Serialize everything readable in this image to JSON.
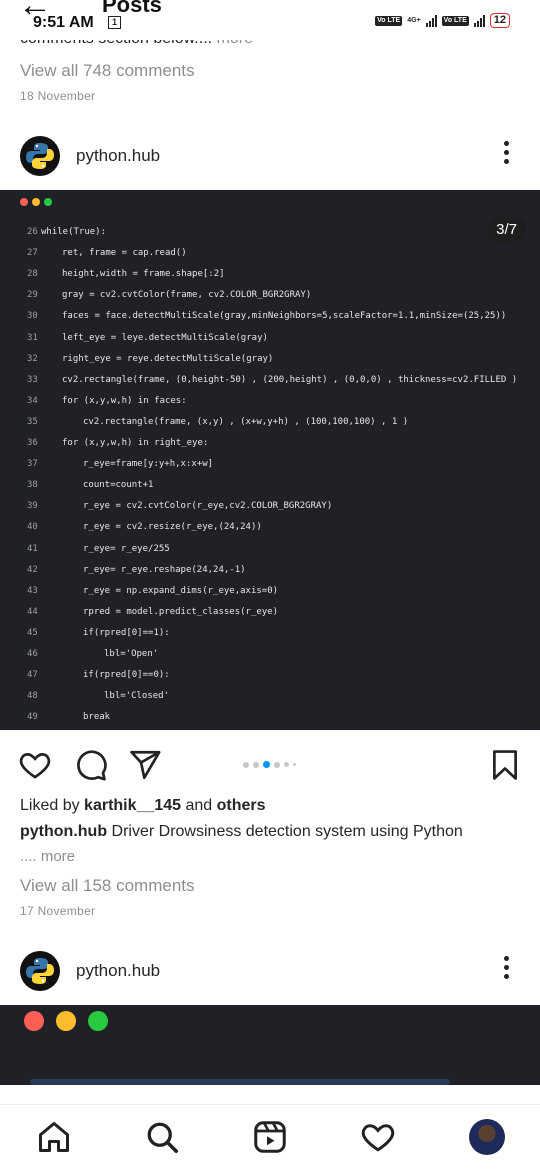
{
  "status_bar": {
    "time": "9:51 AM",
    "notif_count": "1",
    "network_label": "4G+",
    "volte": "Vo LTE",
    "battery": "12"
  },
  "header": {
    "title": "Posts"
  },
  "prev_post": {
    "caption_cut": "comments section below....",
    "more": "more",
    "view_comments": "View all 748 comments",
    "date": "18 November"
  },
  "post": {
    "username": "python.hub",
    "counter": "3/7",
    "code_lines": [
      {
        "ln": "26",
        "text": "while(True):",
        "indent": 0
      },
      {
        "ln": "27",
        "text": "ret, frame = cap.read()",
        "indent": 1
      },
      {
        "ln": "28",
        "text": "height,width = frame.shape[:2]",
        "indent": 1
      },
      {
        "ln": "29",
        "text": "gray = cv2.cvtColor(frame, cv2.COLOR_BGR2GRAY)",
        "indent": 1
      },
      {
        "ln": "30",
        "text": "faces = face.detectMultiScale(gray,minNeighbors=5,scaleFactor=1.1,minSize=(25,25))",
        "indent": 1
      },
      {
        "ln": "31",
        "text": "left_eye = leye.detectMultiScale(gray)",
        "indent": 1
      },
      {
        "ln": "32",
        "text": "right_eye = reye.detectMultiScale(gray)",
        "indent": 1
      },
      {
        "ln": "33",
        "text": "cv2.rectangle(frame, (0,height-50) , (200,height) , (0,0,0) , thickness=cv2.FILLED )",
        "indent": 1
      },
      {
        "ln": "34",
        "text": "for (x,y,w,h) in faces:",
        "indent": 1
      },
      {
        "ln": "35",
        "text": "cv2.rectangle(frame, (x,y) , (x+w,y+h) , (100,100,100) , 1 )",
        "indent": 2
      },
      {
        "ln": "36",
        "text": "for (x,y,w,h) in right_eye:",
        "indent": 1
      },
      {
        "ln": "37",
        "text": "r_eye=frame[y:y+h,x:x+w]",
        "indent": 2
      },
      {
        "ln": "38",
        "text": "count=count+1",
        "indent": 2
      },
      {
        "ln": "39",
        "text": "r_eye = cv2.cvtColor(r_eye,cv2.COLOR_BGR2GRAY)",
        "indent": 2
      },
      {
        "ln": "40",
        "text": "r_eye = cv2.resize(r_eye,(24,24))",
        "indent": 2
      },
      {
        "ln": "41",
        "text": "r_eye= r_eye/255",
        "indent": 2
      },
      {
        "ln": "42",
        "text": "r_eye= r_eye.reshape(24,24,-1)",
        "indent": 2
      },
      {
        "ln": "43",
        "text": "r_eye = np.expand_dims(r_eye,axis=0)",
        "indent": 2
      },
      {
        "ln": "44",
        "text": "rpred = model.predict_classes(r_eye)",
        "indent": 2
      },
      {
        "ln": "45",
        "text": "if(rpred[0]==1):",
        "indent": 2
      },
      {
        "ln": "46",
        "text": "lbl='Open'",
        "indent": 3
      },
      {
        "ln": "47",
        "text": "if(rpred[0]==0):",
        "indent": 2
      },
      {
        "ln": "48",
        "text": "lbl='Closed'",
        "indent": 3
      },
      {
        "ln": "49",
        "text": "break",
        "indent": 2
      }
    ],
    "liked_by_prefix": "Liked by ",
    "liked_by_user": "karthik__145",
    "liked_by_mid": " and ",
    "liked_by_others": "others",
    "caption_user": "python.hub",
    "caption_text": " Driver Drowsiness detection system using Python",
    "caption_more": ".... more",
    "view_comments": "View all 158 comments",
    "date": "17 November"
  },
  "next_post": {
    "username": "python.hub"
  },
  "colors": {
    "code_bg": "#202126",
    "dot_red": "#ff5f56",
    "dot_yellow": "#ffbd2e",
    "dot_green": "#27c93f",
    "muted": "#8e8e8e"
  },
  "icons": [
    "back-arrow-icon",
    "more-icon",
    "heart-icon",
    "comment-icon",
    "share-icon",
    "bookmark-icon",
    "home-icon",
    "search-icon",
    "reels-icon",
    "activity-icon"
  ]
}
